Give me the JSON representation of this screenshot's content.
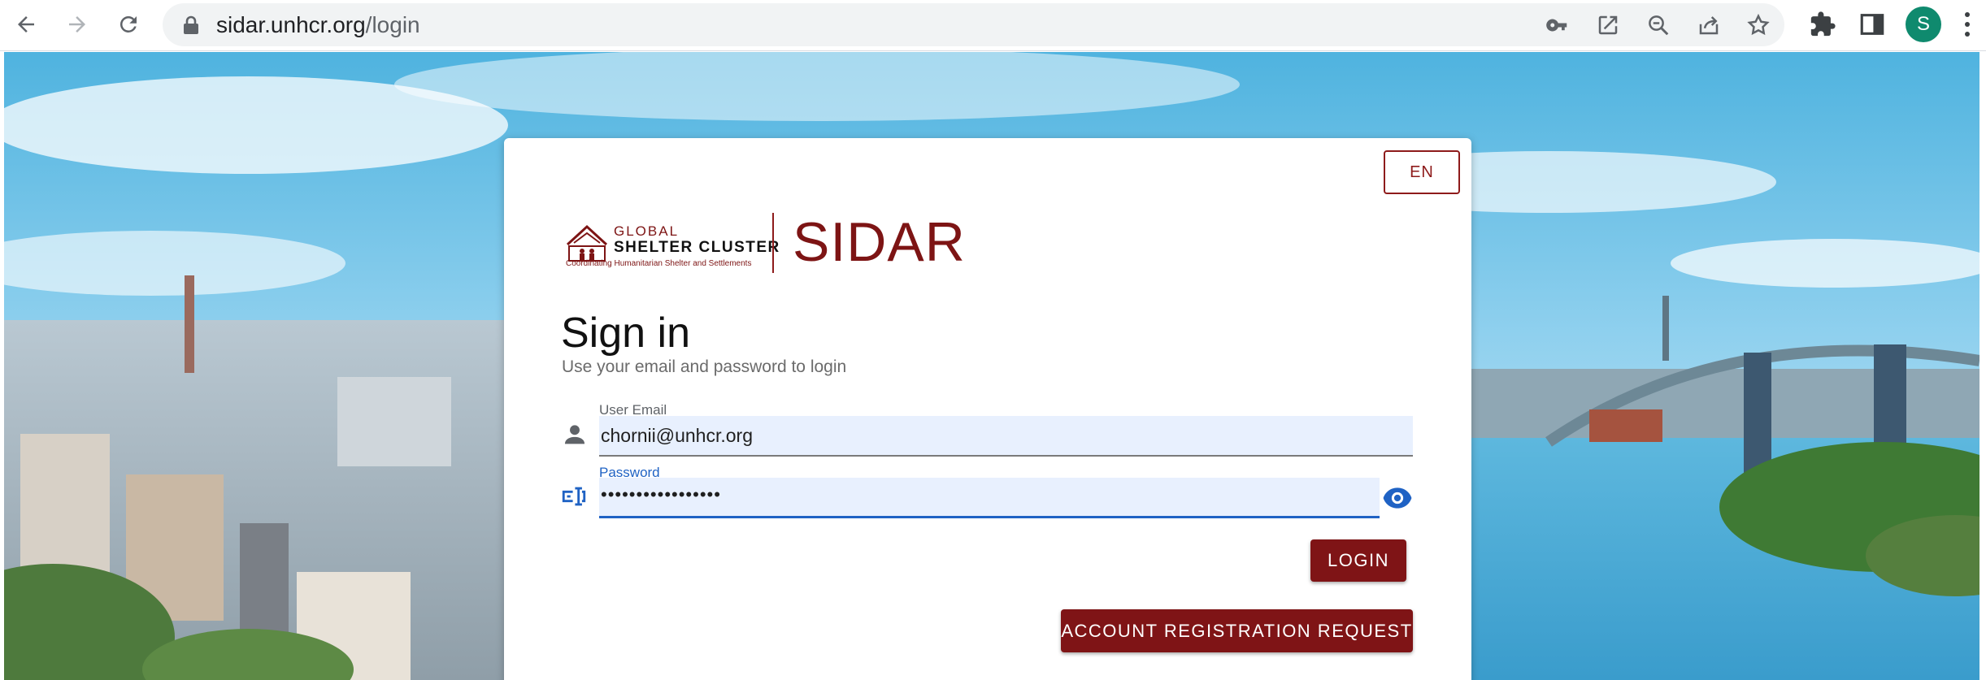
{
  "browser": {
    "url_host": "sidar.unhcr.org",
    "url_path": "/login",
    "profile_initial": "S",
    "icons": [
      "back-arrow-icon",
      "forward-arrow-icon",
      "reload-icon",
      "lock-icon",
      "key-icon",
      "open-in-new-icon",
      "zoom-out-icon",
      "share-icon",
      "star-icon",
      "extensions-icon",
      "side-panel-icon",
      "menu-dots-icon"
    ]
  },
  "card": {
    "language": "EN",
    "logo": {
      "global": "GLOBAL",
      "shelter_cluster": "SHELTER CLUSTER",
      "tagline": "Coordinating Humanitarian Shelter and Settlements"
    },
    "app_name": "SIDAR",
    "title": "Sign in",
    "subtitle": "Use your email and password to login",
    "email": {
      "label": "User Email",
      "value": "chornii@unhcr.org"
    },
    "password": {
      "label": "Password",
      "value": "•••••••••••••••••"
    },
    "login_button": "LOGIN",
    "register_button": "ACCOUNT REGISTRATION REQUEST"
  },
  "colors": {
    "brand": "#7f1416",
    "focus": "#1f62c4",
    "field_bg": "#e8f0fe"
  }
}
